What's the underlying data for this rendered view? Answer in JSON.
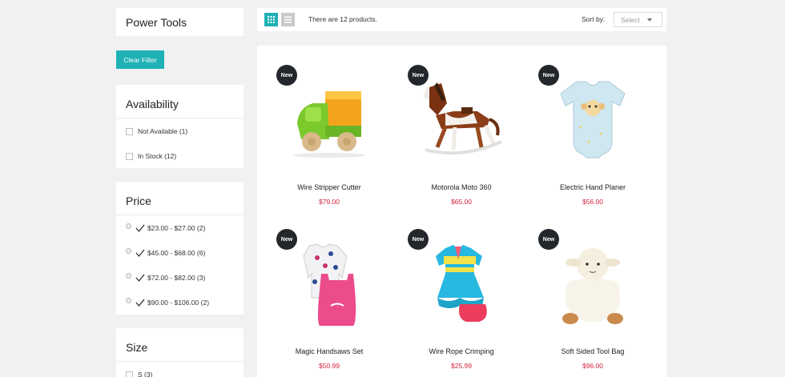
{
  "category": {
    "title": "Power Tools"
  },
  "filters": {
    "clear_label": "Clear Filter",
    "availability": {
      "title": "Availability",
      "options": [
        {
          "label": "Not Available (1)"
        },
        {
          "label": "In Stock (12)"
        }
      ]
    },
    "price": {
      "title": "Price",
      "options": [
        {
          "label": "$23.00 - $27.00 (2)"
        },
        {
          "label": "$45.00 - $68.00 (6)"
        },
        {
          "label": "$72.00 - $82.00 (3)"
        },
        {
          "label": "$90.00 - $106.00 (2)"
        }
      ]
    },
    "size": {
      "title": "Size",
      "options": [
        {
          "label": "S (3)"
        }
      ]
    }
  },
  "toolbar": {
    "count_text": "There are 12 products.",
    "sort_label": "Sort by:",
    "sort_value": "Select"
  },
  "products": [
    {
      "badge": "New",
      "name": "Wire Stripper Cutter",
      "price": "$79.00",
      "image": "toy-truck"
    },
    {
      "badge": "New",
      "name": "Motorola Moto 360",
      "price": "$65.00",
      "image": "rocking-horse"
    },
    {
      "badge": "New",
      "name": "Electric Hand Planer",
      "price": "$56.00",
      "image": "baby-onesie"
    },
    {
      "badge": "New",
      "name": "Magic Handsaws Set",
      "price": "$50.99",
      "image": "baby-dress-set"
    },
    {
      "badge": "New",
      "name": "Wire Rope Crimping",
      "price": "$25.99",
      "image": "striped-dress"
    },
    {
      "badge": "New",
      "name": "Soft Sided Tool Bag",
      "price": "$96.00",
      "image": "plush-sheep"
    }
  ],
  "colors": {
    "accent": "#1fb1b5",
    "price": "#d0243c",
    "badge": "#23272b"
  }
}
